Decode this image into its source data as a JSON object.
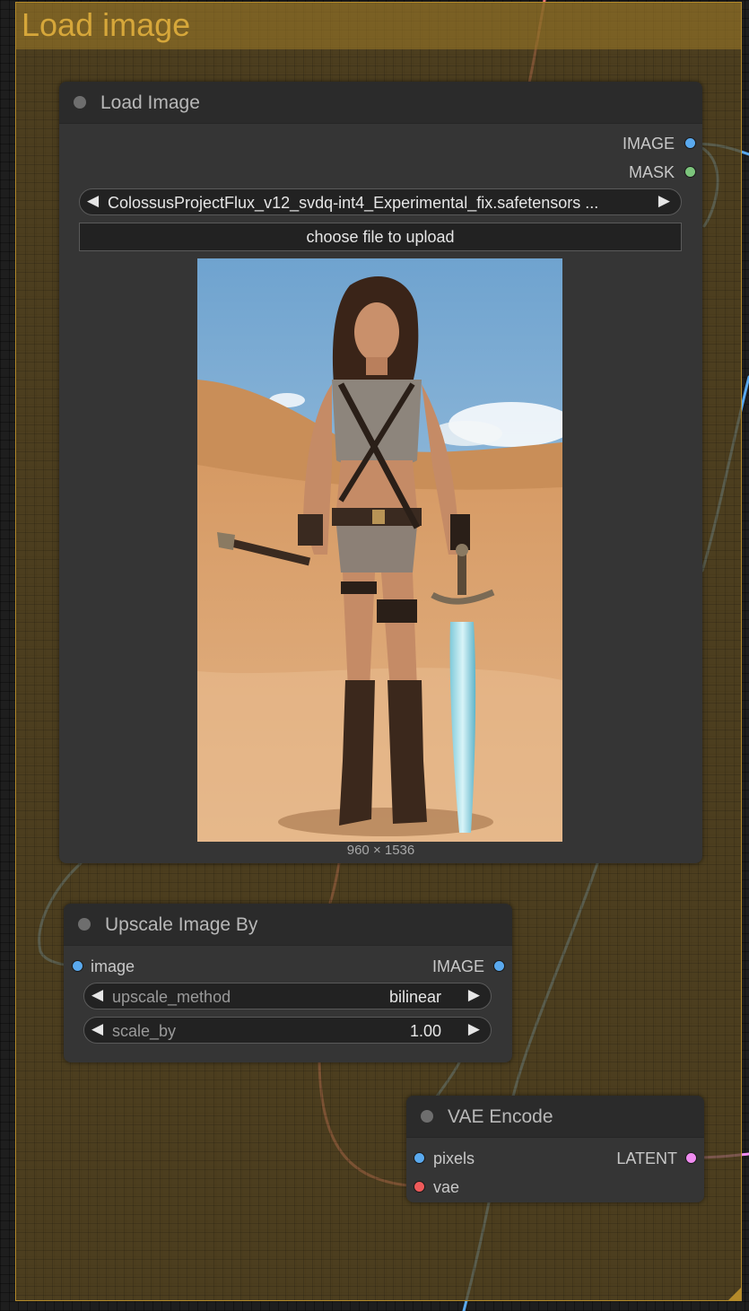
{
  "group": {
    "title": "Load image",
    "color": "#b58b2a"
  },
  "load_image": {
    "title": "Load Image",
    "outputs": [
      {
        "label": "IMAGE",
        "color": "#5aa9ee"
      },
      {
        "label": "MASK",
        "color": "#7cc47c"
      }
    ],
    "file_combo": {
      "value": "ColossusProjectFlux_v12_svdq-int4_Experimental_fix.safetensors  ..."
    },
    "upload_button": "choose file to upload",
    "preview_size": "960 × 1536"
  },
  "upscale": {
    "title": "Upscale Image By",
    "input": {
      "label": "image",
      "color": "#5aa9ee"
    },
    "output": {
      "label": "IMAGE",
      "color": "#5aa9ee"
    },
    "widgets": [
      {
        "name": "upscale_method",
        "value": "bilinear"
      },
      {
        "name": "scale_by",
        "value": "1.00"
      }
    ]
  },
  "vae_encode": {
    "title": "VAE Encode",
    "inputs": [
      {
        "label": "pixels",
        "color": "#5aa9ee"
      },
      {
        "label": "vae",
        "color": "#ee5a5a"
      }
    ],
    "output": {
      "label": "LATENT",
      "color": "#f08cf0"
    }
  },
  "wire_colors": {
    "image": "#5aa9ee",
    "vae": "#f07878",
    "latent": "#f08cf0"
  }
}
